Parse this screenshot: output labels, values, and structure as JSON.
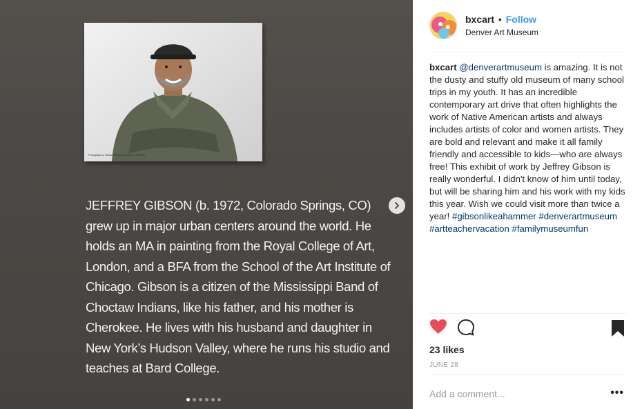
{
  "post": {
    "username": "bxcart",
    "separator": "•",
    "follow_label": "Follow",
    "location": "Denver Art Museum",
    "caption": {
      "username": "bxcart",
      "mention": "@denverartmuseum",
      "body": "is amazing. It is not the dusty and stuffy old museum of many school trips in my youth. It has an incredible contemporary art drive that often highlights the work of Native American artists and always includes artists of color and women artists. They are bold and relevant and make it all family friendly and accessible to kids—who are always free! This exhibit of work by Jeffrey Gibson is really wonderful. I didn't know of him until today, but will be sharing him and his work with my kids this year. Wish we could visit more than twice a year!",
      "hashtags": [
        "#gibsonlikeahammer",
        "#denverartmuseum",
        "#artteachervacation",
        "#familymuseumfun"
      ]
    },
    "likes": "23 likes",
    "date": "JUNE 28",
    "comment_placeholder": "Add a comment...",
    "more_label": "•••"
  },
  "media": {
    "photo_credit": "Photograph by Jessica Shinking courtesy of the Artist",
    "placard_text": "JEFFREY GIBSON (b. 1972, Colorado Springs, CO) grew up in major urban centers around the world. He holds an MA in painting from the Royal College of Art, London, and a BFA from the School of the Art Institute of Chicago. Gibson is a citizen of the Mississippi Band of Choctaw Indians, like his father, and his mother is Cherokee. He lives with his husband and daughter in New York’s Hudson Valley, where he runs his studio and teaches at Bard College.",
    "carousel": {
      "total": 6,
      "active": 1
    }
  },
  "icons": {
    "like": "heart-filled-icon",
    "comment": "comment-bubble-icon",
    "save": "bookmark-filled-icon",
    "next": "chevron-right-icon"
  },
  "colors": {
    "like_red": "#ed4956",
    "follow_blue": "#3897f0",
    "link_blue": "#003569"
  }
}
